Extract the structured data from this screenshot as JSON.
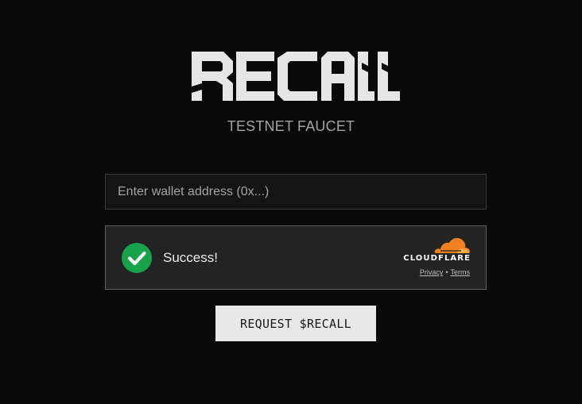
{
  "brand": {
    "logo_text": "RECALL",
    "subtitle": "TESTNET FAUCET"
  },
  "wallet_field": {
    "value": "",
    "placeholder": "Enter wallet address (0x...)"
  },
  "captcha": {
    "status_text": "Success!",
    "status_icon": "check-circle-icon",
    "status_color": "#16a34a",
    "provider_icon": "cloudflare-cloud-icon",
    "provider_name": "CLOUDFLARE",
    "provider_color": "#f38020",
    "privacy_link": "Privacy",
    "separator": "•",
    "terms_link": "Terms"
  },
  "actions": {
    "request_label": "REQUEST $RECALL"
  }
}
